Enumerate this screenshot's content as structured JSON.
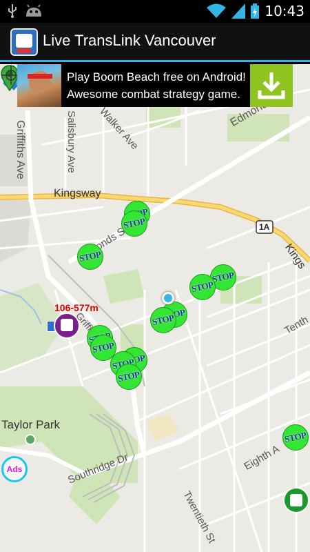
{
  "status_bar": {
    "time": "10:43",
    "icons": [
      "usb-icon",
      "android-icon",
      "wifi-icon",
      "signal-icon",
      "battery-icon"
    ]
  },
  "app": {
    "title": "Live TransLink Vancouver",
    "accent_color": "#33b5e5"
  },
  "ad": {
    "line1": "Play Boom Beach free on Android!",
    "line2": "Awesome combat strategy game.",
    "button_color": "#8fc31f"
  },
  "map": {
    "streets": {
      "kingsway": "Kingsway",
      "kings": "Kings",
      "griffiths": "Griffiths Ave",
      "salisbury": "Salisbury Ave",
      "walker": "Walker Ave",
      "edmonds_top": "Edmond",
      "edmonds": "Edmonds St",
      "southridge": "Southridge Dr",
      "twentieth": "Twentieth St",
      "eighth": "Eighth A",
      "tenth": "Tenth",
      "route_1a": "1A",
      "taylor_park": "Taylor Park",
      "griff_short": "Griffi"
    },
    "stop_label": "STOP",
    "stop_color": "#33e633",
    "bus": {
      "label": "106-577m",
      "color": "#7a1f8c"
    }
  },
  "controls": {
    "ads_label": "Ads",
    "ads_color": "#e020e0"
  }
}
